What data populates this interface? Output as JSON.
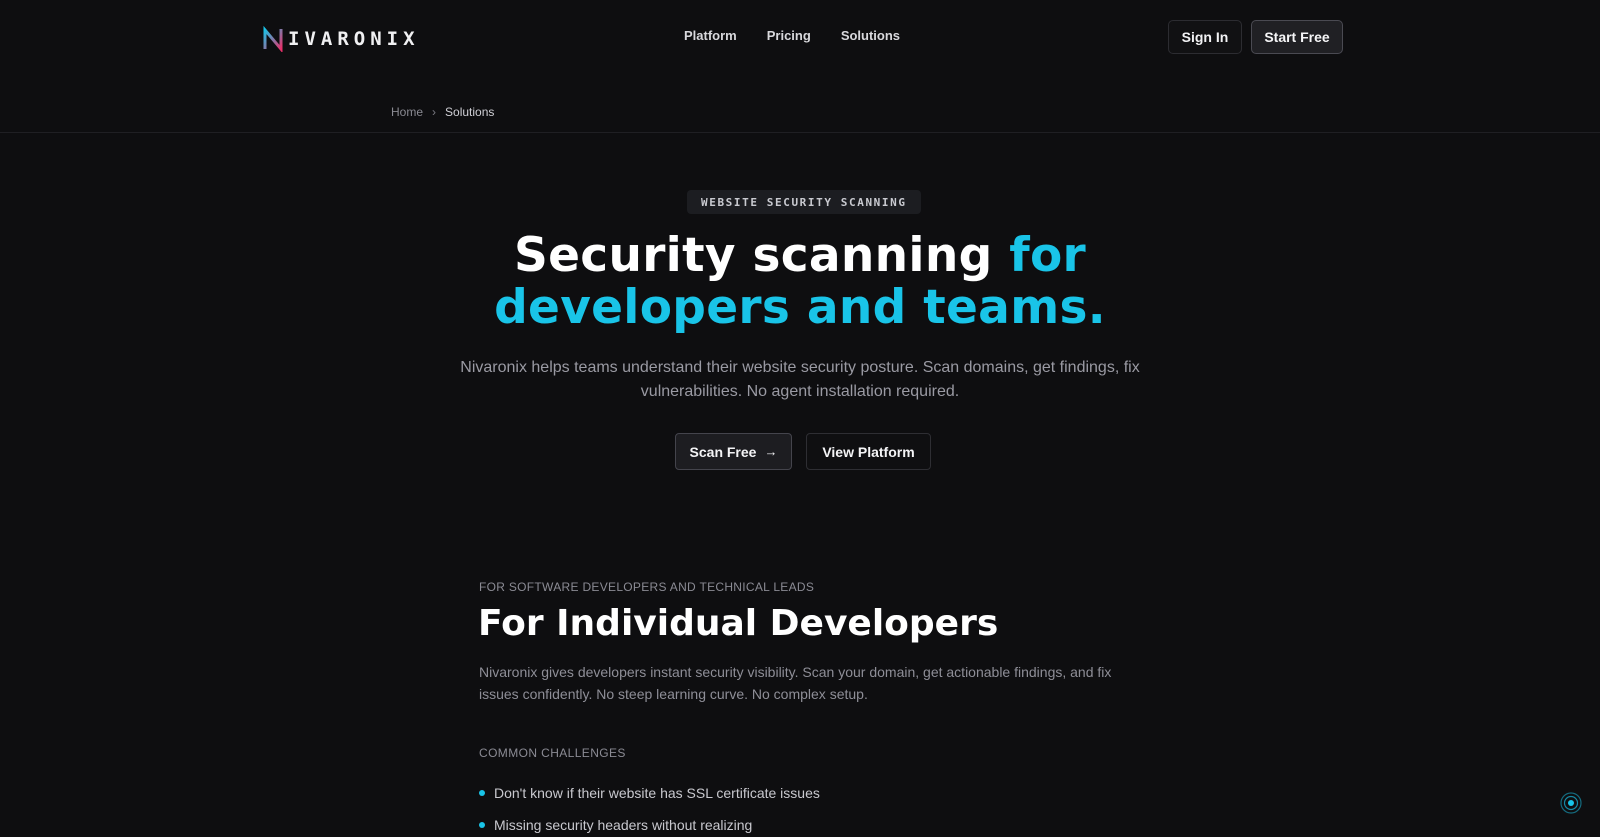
{
  "header": {
    "logo_text": "IVARONIX",
    "logo_letter": "N",
    "nav": [
      "Platform",
      "Pricing",
      "Solutions"
    ],
    "sign_in_label": "Sign In",
    "start_free_label": "Start Free"
  },
  "breadcrumb": {
    "home": "Home",
    "separator": "›",
    "current": "Solutions"
  },
  "hero": {
    "badge": "WEBSITE SECURITY SCANNING",
    "title_white": "Security scanning ",
    "title_cyan_1": "for",
    "title_cyan_2": "developers and teams.",
    "subtitle": "Nivaronix helps teams understand their website security posture. Scan domains, get findings, fix vulnerabilities. No agent installation required.",
    "primary_cta": "Scan Free",
    "primary_cta_icon": "arrow-right-icon",
    "secondary_cta": "View Platform"
  },
  "section": {
    "eyebrow": "FOR SOFTWARE DEVELOPERS AND TECHNICAL LEADS",
    "title": "For Individual Developers",
    "description": "Nivaronix gives developers instant security visibility. Scan your domain, get actionable findings, and fix issues confidently. No steep learning curve. No complex setup.",
    "challenges_label": "COMMON CHALLENGES",
    "challenges": [
      "Don't know if their website has SSL certificate issues",
      "Missing security headers without realizing"
    ]
  },
  "colors": {
    "background": "#0e0e10",
    "accent": "#19c4e8",
    "text_primary": "#ffffff",
    "text_muted": "#9a9aa3"
  }
}
